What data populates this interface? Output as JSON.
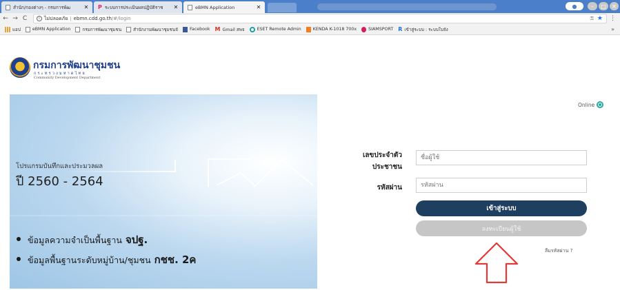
{
  "browser": {
    "tabs": [
      {
        "title": "สำนัก/กองต่างๆ - กรมการพัฒ",
        "favicon": "page-icon",
        "active": false
      },
      {
        "title": "ระบบการประเมินผลปฏิบัติราช",
        "favicon": "p-icon",
        "active": false
      },
      {
        "title": "eBMN Application",
        "favicon": "page-icon",
        "active": true
      }
    ],
    "address": {
      "security_label": "ไม่ปลอดภัย",
      "host": "ebmn.cdd.go.th",
      "path": "/#/login"
    },
    "bookmarks": [
      {
        "label": "แอป",
        "icon": "apps-icon"
      },
      {
        "label": "eBMN Application",
        "icon": "page-icon"
      },
      {
        "label": "กรมการพัฒนาชุมชน",
        "icon": "page-icon"
      },
      {
        "label": "สำนักงานพัฒนาชุมชนจั",
        "icon": "page-icon"
      },
      {
        "label": "Facebook",
        "icon": "facebook-icon"
      },
      {
        "label": "Gmail สพจ",
        "icon": "gmail-icon"
      },
      {
        "label": "ESET Remote Admin",
        "icon": "eset-icon"
      },
      {
        "label": "KENDA K-1018 700x",
        "icon": "kenda-icon"
      },
      {
        "label": "SIAMSPORT",
        "icon": "siamsport-icon"
      },
      {
        "label": "เข้าสู่ระบบ : ระบบใบจัง",
        "icon": "r-icon"
      }
    ]
  },
  "header": {
    "org_name": "กรมการพัฒนาชุมชน",
    "ministry": "กระทรวงมหาดไทย",
    "org_name_en": "Community Development Department"
  },
  "hero": {
    "subtitle": "โปรแกรมบันทึกและประมวลผล",
    "years": "ปี 2560 - 2564",
    "bullets": [
      {
        "text": "ข้อมูลความจำเป็นพื้นฐาน",
        "strong": "จปฐ."
      },
      {
        "text": "ข้อมูลพื้นฐานระดับหมู่บ้าน/ชุมชน",
        "strong": "กชช. 2ค"
      }
    ]
  },
  "login": {
    "status": "Online",
    "id_label_line1": "เลขประจำตัว",
    "id_label_line2": "ประชาชน",
    "username_placeholder": "ชื่อผู้ใช้",
    "password_label": "รหัสผ่าน",
    "password_placeholder": "รหัสผ่าน",
    "login_button": "เข้าสู่ระบบ",
    "register_button": "ลงทะเบียนผู้ใช้",
    "forgot_password": "ลืมรหัสผ่าน ?"
  },
  "colors": {
    "tabstrip": "#4b7fc9",
    "brand_blue": "#1f3f8f",
    "login_button": "#1e3f60",
    "register_button_disabled": "#c6c6c6",
    "annotation_arrow": "#e53935"
  }
}
